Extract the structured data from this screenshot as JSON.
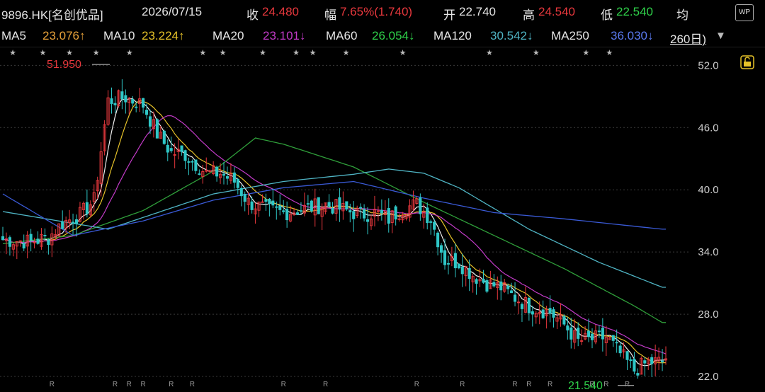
{
  "header": {
    "symbol": "9896.HK[名创优品]",
    "date": "2026/07/15",
    "close_label": "收",
    "close_value": "24.480",
    "range_label": "幅",
    "range_value": "7.65%(1.740)",
    "open_label": "开",
    "open_value": "22.740",
    "high_label": "高",
    "high_value": "24.540",
    "low_label": "低",
    "low_value": "22.540",
    "avg_label": "均",
    "wp_label": "WP"
  },
  "ma": {
    "ma5_label": "MA5",
    "ma5_value": "23.076↑",
    "ma10_label": "MA10",
    "ma10_value": "23.224↑",
    "ma20_label": "MA20",
    "ma20_value": "23.101↓",
    "ma60_label": "MA60",
    "ma60_value": "26.054↓",
    "ma120_label": "MA120",
    "ma120_value": "30.542↓",
    "ma250_label": "MA250",
    "ma250_value": "36.030↓",
    "period_label": "260日)"
  },
  "colors": {
    "up": "#e8383d",
    "down": "#2fc7c7",
    "ma5": "#f0f0f0",
    "ma10": "#e6c229",
    "ma20": "#c33bc8",
    "ma60": "#2f9e3a",
    "ma120": "#4fb4c4",
    "ma250": "#3a5ad6",
    "grid": "#3a3a3a",
    "label_red": "#e8383d",
    "label_green": "#2fd14a"
  },
  "chart_data": {
    "type": "candlestick",
    "ylim": [
      20.5,
      53.8
    ],
    "yticks": [
      "52.0",
      "46.0",
      "40.0",
      "34.0",
      "28.0",
      "22.0"
    ],
    "ytick_values": [
      52,
      46,
      40,
      34,
      28,
      22
    ],
    "high_marker": "51.950",
    "low_marker": "21.540",
    "bars": 100,
    "trend": [
      [
        0,
        35.2
      ],
      [
        8,
        35.0
      ],
      [
        13,
        35.4
      ],
      [
        17,
        36.8
      ],
      [
        22,
        37.6
      ],
      [
        26,
        39.0
      ],
      [
        30,
        48.6
      ],
      [
        35,
        48.9
      ],
      [
        40,
        48.2
      ],
      [
        44,
        45.4
      ],
      [
        48,
        43.6
      ],
      [
        52,
        43.4
      ],
      [
        58,
        41.6
      ],
      [
        62,
        41.6
      ],
      [
        66,
        40.8
      ],
      [
        70,
        38.8
      ],
      [
        76,
        38.0
      ],
      [
        80,
        37.8
      ],
      [
        86,
        38.2
      ],
      [
        92,
        38.6
      ],
      [
        98,
        38.0
      ],
      [
        102,
        37.6
      ],
      [
        106,
        37.8
      ],
      [
        110,
        37.2
      ],
      [
        114,
        38.2
      ],
      [
        118,
        38.6
      ],
      [
        122,
        37.2
      ],
      [
        126,
        33.2
      ],
      [
        130,
        33.0
      ],
      [
        134,
        31.8
      ],
      [
        138,
        31.0
      ],
      [
        142,
        30.6
      ],
      [
        146,
        29.6
      ],
      [
        150,
        28.8
      ],
      [
        156,
        28.2
      ],
      [
        160,
        27.0
      ],
      [
        164,
        25.4
      ],
      [
        168,
        25.6
      ],
      [
        172,
        25.8
      ],
      [
        176,
        24.2
      ],
      [
        180,
        22.6
      ],
      [
        184,
        23.4
      ],
      [
        188,
        23.4
      ],
      [
        190,
        24.2
      ]
    ],
    "ma120_trend": [
      [
        0,
        34.8
      ],
      [
        20,
        35.6
      ],
      [
        40,
        38.0
      ],
      [
        60,
        41.8
      ],
      [
        72,
        45.0
      ],
      [
        80,
        44.4
      ],
      [
        100,
        42.2
      ],
      [
        120,
        38.8
      ],
      [
        140,
        35.6
      ],
      [
        160,
        32.4
      ],
      [
        180,
        28.8
      ],
      [
        188,
        27.2
      ]
    ],
    "ma250_trend": [
      [
        0,
        37.9
      ],
      [
        30,
        36.2
      ],
      [
        60,
        39.6
      ],
      [
        80,
        40.8
      ],
      [
        100,
        41.5
      ],
      [
        110,
        42.0
      ],
      [
        120,
        41.6
      ],
      [
        130,
        40.2
      ],
      [
        150,
        36.2
      ],
      [
        170,
        33.0
      ],
      [
        188,
        30.6
      ]
    ],
    "ma_long_trend": [
      [
        0,
        39.6
      ],
      [
        20,
        35.6
      ],
      [
        40,
        37.0
      ],
      [
        60,
        39.0
      ],
      [
        80,
        40.2
      ],
      [
        100,
        40.8
      ],
      [
        120,
        39.2
      ],
      [
        140,
        37.8
      ],
      [
        160,
        37.2
      ],
      [
        188,
        36.2
      ]
    ]
  }
}
